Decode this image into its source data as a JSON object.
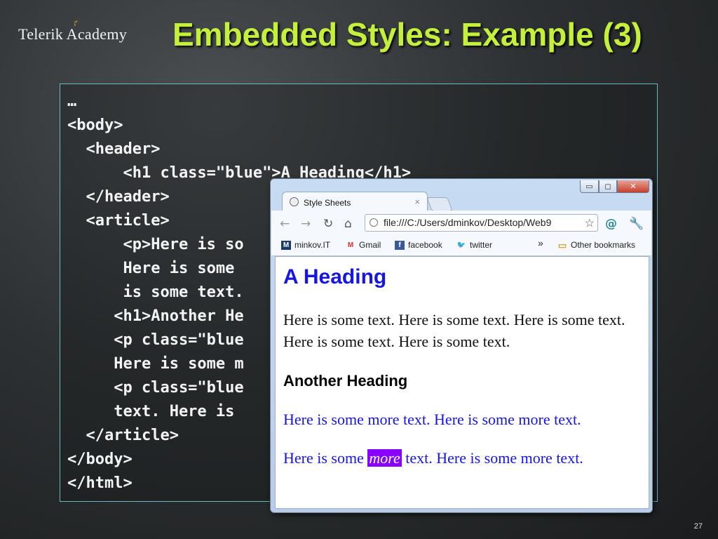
{
  "slide": {
    "logo": "Telerik Academy",
    "title": "Embedded Styles: Example (3)",
    "page_number": "27",
    "code_lines": [
      "…",
      "<body>",
      "  <header>",
      "      <h1 class=\"blue\">A Heading</h1>",
      "  </header>",
      "  <article>",
      "      <p>Here is so",
      "      Here is some",
      "      is some text.",
      "     <h1>Another He",
      "     <p class=\"blue",
      "     Here is some m",
      "     <p class=\"blue",
      "     text. Here is",
      "  </article>",
      "</body>",
      "</html>"
    ]
  },
  "browser": {
    "window_buttons": {
      "minimize": "▭",
      "maximize": "◻",
      "close": "✕"
    },
    "tab_title": "Style Sheets",
    "tab_close": "×",
    "url": "file:///C:/Users/dminkov/Desktop/Web9",
    "bookmarks": [
      {
        "label": "minkov.IT",
        "icon": "m-icon"
      },
      {
        "label": "Gmail",
        "icon": "gmail-icon"
      },
      {
        "label": "facebook",
        "icon": "facebook-icon"
      },
      {
        "label": "twitter",
        "icon": "twitter-icon"
      }
    ],
    "bookmarks_overflow": "»",
    "other_bookmarks": "Other bookmarks",
    "page": {
      "heading1": "A Heading",
      "para1": "Here is some text. Here is some text. Here is some text. Here is some text. Here is some text.",
      "heading2": "Another Heading",
      "para2": "Here is some more text. Here is some more text.",
      "para3_before": "Here is some ",
      "para3_highlight": "more",
      "para3_after": " text. Here is some more text."
    }
  },
  "colors": {
    "title": "#c4ef3b",
    "blue_text": "#1515e6",
    "highlight": "#8a00ff"
  }
}
